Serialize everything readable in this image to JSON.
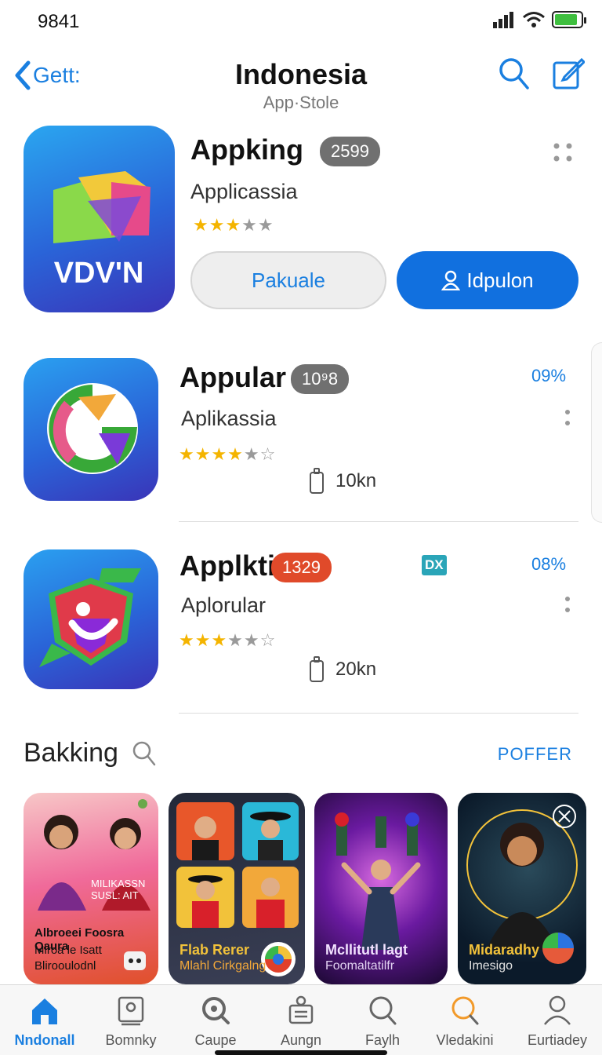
{
  "status": {
    "time": "9841"
  },
  "nav": {
    "back_label": "Gett:",
    "title": "Indonesia",
    "subtitle": "App·Stole"
  },
  "featured": {
    "name": "Appking",
    "badge": "2599",
    "subtitle": "Applicassia",
    "rating": 3,
    "icon_text": "VDV'N",
    "secondary_button": "Pakuale",
    "primary_button": "Idpulon"
  },
  "apps": [
    {
      "name": "Appular",
      "badge": "10⁹8",
      "badge_color": "#707070",
      "subtitle": "Aplikassia",
      "rating": 4,
      "percent": "09%",
      "downloads": "10kn"
    },
    {
      "name": "Applkti",
      "badge": "1329",
      "badge_color": "#e04a2a",
      "subtitle": "Aplorular",
      "rating": 3,
      "percent": "08%",
      "downloads": "20kn",
      "tag": "DX"
    }
  ],
  "section": {
    "title": "Bakking",
    "link": "POFFER"
  },
  "cards": [
    {
      "line1": "Albroeei Foosra Qaura",
      "line2": "Mlroa le Isatt",
      "line3": "Blirooulodnl",
      "overlay": "MILIKASSN SUSL: AIT",
      "colors": [
        "#f06a9a",
        "#e0502a"
      ]
    },
    {
      "line1": "Flab Rerer",
      "line2": "Mlahl Cirkgalng",
      "colors": [
        "#222838",
        "#3a3f55"
      ]
    },
    {
      "line1": "Mcllitutl lagt",
      "line2": "Foomaltatilfr",
      "colors": [
        "#3a1060",
        "#8a2aa8"
      ]
    },
    {
      "line1": "Midaradhy",
      "line2": "Imesigo",
      "colors": [
        "#0b1a2a",
        "#1f3340"
      ]
    }
  ],
  "tabs": [
    {
      "label": "Nndonall",
      "icon": "home-icon",
      "active": true
    },
    {
      "label": "Bomnky",
      "icon": "frame-icon"
    },
    {
      "label": "Caupe",
      "icon": "search-zoom-icon"
    },
    {
      "label": "Aungn",
      "icon": "box-icon"
    },
    {
      "label": "Faylh",
      "icon": "search-icon"
    },
    {
      "label": "Vledakini",
      "icon": "search-orange-icon"
    },
    {
      "label": "Eurtiadey",
      "icon": "person-icon"
    }
  ],
  "colors": {
    "accent": "#1a7fe0",
    "primary_button": "#1170df",
    "star": "#f4b400"
  }
}
